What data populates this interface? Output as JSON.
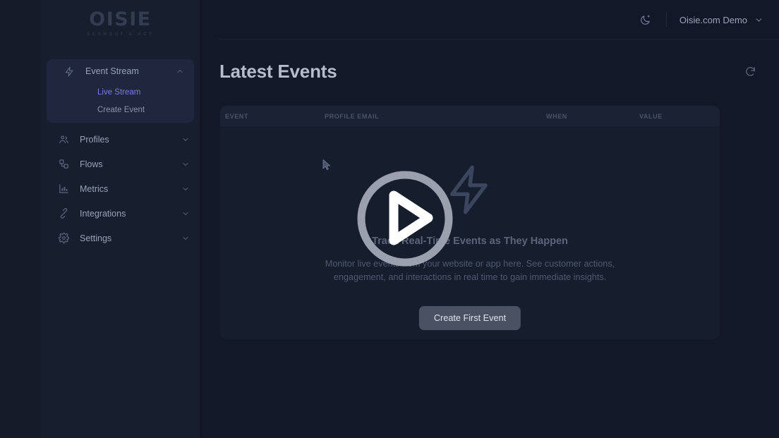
{
  "brand": {
    "logo_text": "OISIE",
    "tagline": "SEGMENT & ACT"
  },
  "sidebar": {
    "active_group": "Event Stream",
    "groups": [
      {
        "label": "Event Stream",
        "icon": "bolt-icon",
        "chevron": "chevron-up-icon",
        "expanded": true,
        "children": [
          {
            "label": "Live Stream",
            "active": true
          },
          {
            "label": "Create Event",
            "active": false
          }
        ]
      },
      {
        "label": "Profiles",
        "icon": "users-icon",
        "chevron": "chevron-down-icon",
        "expanded": false,
        "children": []
      },
      {
        "label": "Flows",
        "icon": "flows-icon",
        "chevron": "chevron-down-icon",
        "expanded": false,
        "children": []
      },
      {
        "label": "Metrics",
        "icon": "chart-icon",
        "chevron": "chevron-down-icon",
        "expanded": false,
        "children": []
      },
      {
        "label": "Integrations",
        "icon": "plug-icon",
        "chevron": "chevron-down-icon",
        "expanded": false,
        "children": []
      },
      {
        "label": "Settings",
        "icon": "gear-icon",
        "chevron": "chevron-down-icon",
        "expanded": false,
        "children": []
      }
    ],
    "collapse_icon": "collapse-sidebar-icon"
  },
  "topbar": {
    "theme_toggle_icon": "moon-icon",
    "account_name": "Oisie.com Demo",
    "account_chevron_icon": "chevron-down-icon"
  },
  "page": {
    "title": "Latest Events",
    "refresh_icon": "refresh-icon"
  },
  "table": {
    "columns": [
      "EVENT",
      "PROFILE EMAIL",
      "WHEN",
      "VALUE"
    ],
    "rows": []
  },
  "empty_state": {
    "icon": "bolt-icon",
    "title": "Track Real-Time Events as They Happen",
    "description": "Monitor live events from your website or app here. See customer actions, engagement, and interactions in real time to gain immediate insights.",
    "button_label": "Create First Event"
  },
  "overlay": {
    "play_icon": "play-button-icon"
  },
  "cursor": {
    "icon": "mouse-cursor-icon"
  },
  "colors": {
    "app_bg": "#0f1420",
    "rail_bg": "#151b29",
    "sidebar_bg": "#171e2d",
    "main_bg": "#121828",
    "card_bg": "#161d2d",
    "table_head_bg": "#1b2233",
    "accent_active": "#7b7ce0",
    "button_bg": "#4a5163"
  }
}
